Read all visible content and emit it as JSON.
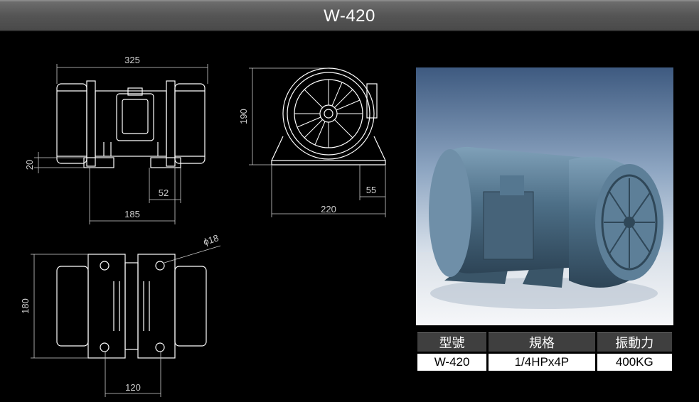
{
  "header": {
    "title": "W-420"
  },
  "dimensions": {
    "side_view": {
      "overall_length": "325",
      "base_height": "20",
      "foot_width": "52",
      "base_length": "185"
    },
    "front_view": {
      "height": "190",
      "foot_width": "55",
      "base_width": "220"
    },
    "top_view": {
      "hole_diameter": "ϕ18",
      "depth": "180",
      "hole_spacing": "120"
    }
  },
  "photo": {
    "icon": "vibration-motor-render"
  },
  "spec_table": {
    "headers": [
      "型號",
      "規格",
      "振動力"
    ],
    "row": [
      "W-420",
      "1/4HPx4P",
      "400KG"
    ]
  },
  "colors": {
    "header": "#555555",
    "line": "#ffffff",
    "table_header": "#3f3f3f"
  }
}
